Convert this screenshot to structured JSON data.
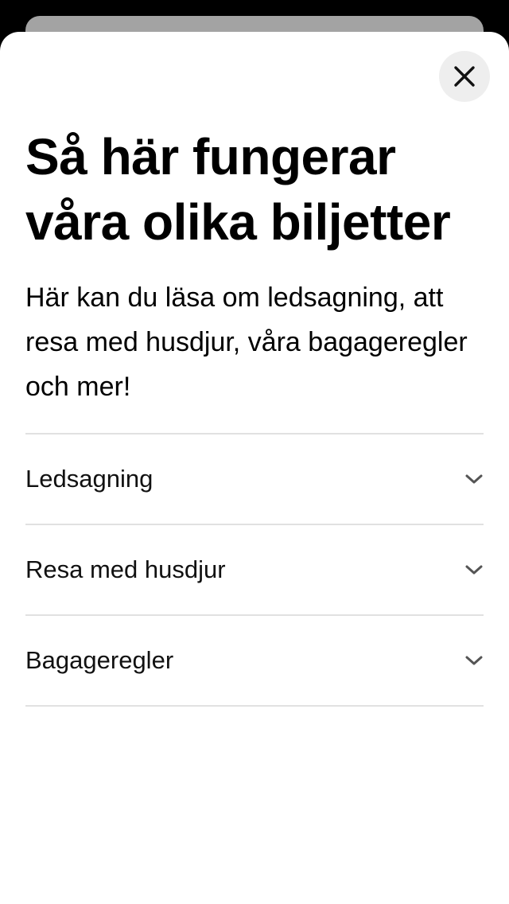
{
  "title": "Så här fungerar våra olika biljetter",
  "intro": "Här kan du läsa om ledsagning, att resa med husdjur, våra bagageregler och mer!",
  "close_icon": "close-icon",
  "accordion": {
    "items": [
      {
        "label": "Ledsagning",
        "icon": "chevron-down-icon"
      },
      {
        "label": "Resa med husdjur",
        "icon": "chevron-down-icon"
      },
      {
        "label": "Bagageregler",
        "icon": "chevron-down-icon"
      }
    ]
  },
  "colors": {
    "sheet_background": "#ffffff",
    "backdrop": "#000000",
    "close_button_background": "#eeeeee",
    "divider": "#e1e1e1",
    "chevron": "#555555"
  }
}
